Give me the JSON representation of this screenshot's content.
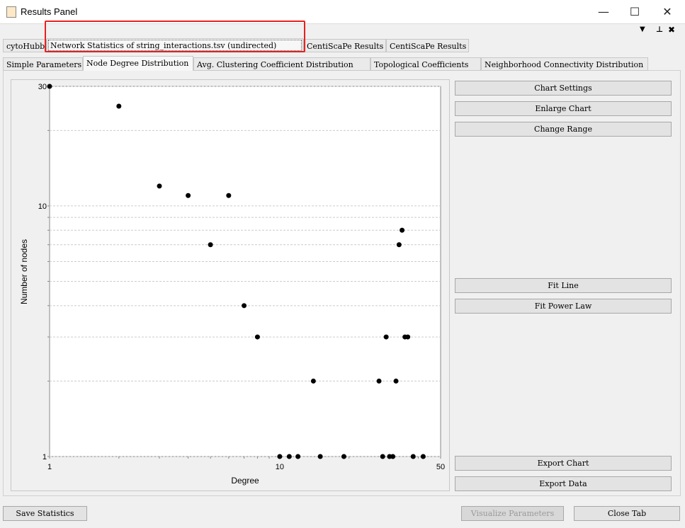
{
  "window": {
    "title": "Results Panel",
    "controls": [
      "—",
      "☐",
      "✕"
    ]
  },
  "panel_controls": {
    "dropdown": "▼",
    "pin": "📌",
    "close": "✖"
  },
  "outer_tabs": [
    {
      "label": "cytoHubba",
      "selected": false
    },
    {
      "label": "Network Statistics of string_interactions.tsv (undirected)",
      "selected": true
    },
    {
      "label": "CentiScaPe Results",
      "selected": false
    },
    {
      "label": "CentiScaPe Results",
      "selected": false
    }
  ],
  "inner_tabs": [
    {
      "label": "Simple Parameters",
      "selected": false
    },
    {
      "label": "Node Degree Distribution",
      "selected": true
    },
    {
      "label": "Avg. Clustering Coefficient Distribution",
      "selected": false
    },
    {
      "label": "Topological Coefficients",
      "selected": false
    },
    {
      "label": "Neighborhood Connectivity Distribution",
      "selected": false
    }
  ],
  "side_buttons": {
    "chart_settings": "Chart Settings",
    "enlarge_chart": "Enlarge Chart",
    "change_range": "Change Range",
    "fit_line": "Fit Line",
    "fit_power_law": "Fit Power Law",
    "export_chart": "Export Chart",
    "export_data": "Export Data"
  },
  "bottom_buttons": {
    "save_statistics": "Save Statistics",
    "visualize_parameters": "Visualize Parameters",
    "close_tab": "Close Tab"
  },
  "highlight_color": "#e8201e",
  "chart_data": {
    "type": "scatter",
    "xlabel": "Degree",
    "ylabel": "Number of nodes",
    "xscale": "log",
    "yscale": "log",
    "xlim": [
      1,
      50
    ],
    "ylim": [
      1,
      30
    ],
    "xticks": [
      1,
      10,
      50
    ],
    "yticks": [
      1,
      10,
      30
    ],
    "grid": "horizontal dashed",
    "points": [
      [
        1,
        30
      ],
      [
        2,
        25
      ],
      [
        3,
        12
      ],
      [
        4,
        11
      ],
      [
        5,
        7
      ],
      [
        6,
        11
      ],
      [
        7,
        4
      ],
      [
        8,
        3
      ],
      [
        10,
        1
      ],
      [
        11,
        1
      ],
      [
        12,
        1
      ],
      [
        14,
        2
      ],
      [
        15,
        1
      ],
      [
        19,
        1
      ],
      [
        27,
        2
      ],
      [
        28,
        1
      ],
      [
        29,
        3
      ],
      [
        30,
        1
      ],
      [
        31,
        1
      ],
      [
        32,
        2
      ],
      [
        33,
        7
      ],
      [
        34,
        8
      ],
      [
        35,
        3
      ],
      [
        36,
        3
      ],
      [
        38,
        1
      ],
      [
        42,
        1
      ]
    ]
  }
}
